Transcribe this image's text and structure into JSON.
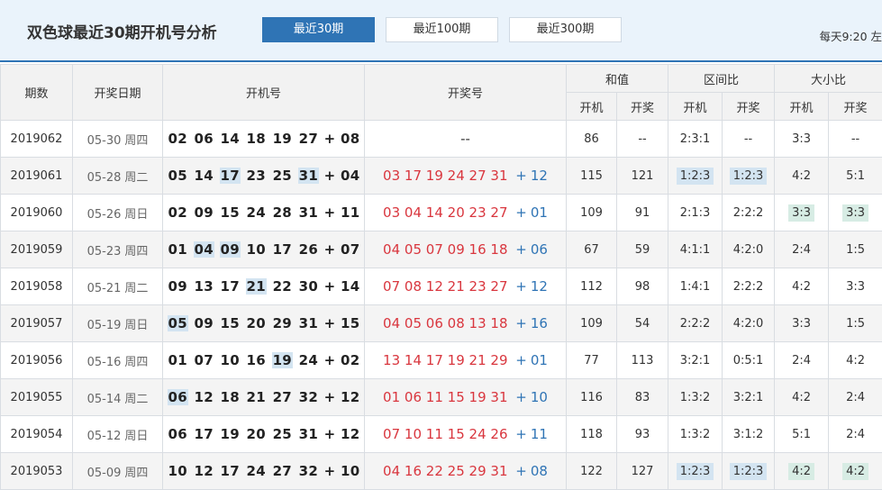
{
  "header": {
    "title": "双色球最近30期开机号分析",
    "tabs": [
      {
        "label": "最近30期",
        "active": true
      },
      {
        "label": "最近100期",
        "active": false
      },
      {
        "label": "最近300期",
        "active": false
      }
    ],
    "update_note": "每天9:20 左"
  },
  "columns": {
    "period": "期数",
    "date": "开奖日期",
    "machine": "开机号",
    "draw": "开奖号",
    "sum": "和值",
    "zone": "区间比",
    "size": "大小比",
    "sub_machine": "开机",
    "sub_draw": "开奖"
  },
  "colors": {
    "accent": "#2f74b5",
    "red_ball": "#d9363e",
    "blue_ball": "#2f74b5",
    "highlight": "#d3e4f1",
    "highlight_green": "#d7ece4"
  },
  "rows": [
    {
      "period": "2019062",
      "date": "05-30",
      "weekday": "周四",
      "machine_red": [
        "02",
        "06",
        "14",
        "18",
        "19",
        "27"
      ],
      "machine_blue": "08",
      "machine_hl": [],
      "draw_red": [],
      "draw_blue": "",
      "draw_empty": "--",
      "plus": "+",
      "sum_m": "86",
      "sum_d": "--",
      "zone_m": "2:3:1",
      "zone_d": "--",
      "zone_hl": false,
      "size_m": "3:3",
      "size_d": "--",
      "size_hl": false
    },
    {
      "period": "2019061",
      "date": "05-28",
      "weekday": "周二",
      "machine_red": [
        "05",
        "14",
        "17",
        "23",
        "25",
        "31"
      ],
      "machine_blue": "04",
      "machine_hl": [
        2,
        5
      ],
      "draw_red": [
        "03",
        "17",
        "19",
        "24",
        "27",
        "31"
      ],
      "draw_blue": "12",
      "plus": "+",
      "sum_m": "115",
      "sum_d": "121",
      "zone_m": "1:2:3",
      "zone_d": "1:2:3",
      "zone_hl": true,
      "size_m": "4:2",
      "size_d": "5:1",
      "size_hl": false
    },
    {
      "period": "2019060",
      "date": "05-26",
      "weekday": "周日",
      "machine_red": [
        "02",
        "09",
        "15",
        "24",
        "28",
        "31"
      ],
      "machine_blue": "11",
      "machine_hl": [],
      "draw_red": [
        "03",
        "04",
        "14",
        "20",
        "23",
        "27"
      ],
      "draw_blue": "01",
      "plus": "+",
      "sum_m": "109",
      "sum_d": "91",
      "zone_m": "2:1:3",
      "zone_d": "2:2:2",
      "zone_hl": false,
      "size_m": "3:3",
      "size_d": "3:3",
      "size_hl": true
    },
    {
      "period": "2019059",
      "date": "05-23",
      "weekday": "周四",
      "machine_red": [
        "01",
        "04",
        "09",
        "10",
        "17",
        "26"
      ],
      "machine_blue": "07",
      "machine_hl": [
        1,
        2
      ],
      "draw_red": [
        "04",
        "05",
        "07",
        "09",
        "16",
        "18"
      ],
      "draw_blue": "06",
      "plus": "+",
      "sum_m": "67",
      "sum_d": "59",
      "zone_m": "4:1:1",
      "zone_d": "4:2:0",
      "zone_hl": false,
      "size_m": "2:4",
      "size_d": "1:5",
      "size_hl": false
    },
    {
      "period": "2019058",
      "date": "05-21",
      "weekday": "周二",
      "machine_red": [
        "09",
        "13",
        "17",
        "21",
        "22",
        "30"
      ],
      "machine_blue": "14",
      "machine_hl": [
        3
      ],
      "draw_red": [
        "07",
        "08",
        "12",
        "21",
        "23",
        "27"
      ],
      "draw_blue": "12",
      "plus": "+",
      "sum_m": "112",
      "sum_d": "98",
      "zone_m": "1:4:1",
      "zone_d": "2:2:2",
      "zone_hl": false,
      "size_m": "4:2",
      "size_d": "3:3",
      "size_hl": false
    },
    {
      "period": "2019057",
      "date": "05-19",
      "weekday": "周日",
      "machine_red": [
        "05",
        "09",
        "15",
        "20",
        "29",
        "31"
      ],
      "machine_blue": "15",
      "machine_hl": [
        0
      ],
      "draw_red": [
        "04",
        "05",
        "06",
        "08",
        "13",
        "18"
      ],
      "draw_blue": "16",
      "plus": "+",
      "sum_m": "109",
      "sum_d": "54",
      "zone_m": "2:2:2",
      "zone_d": "4:2:0",
      "zone_hl": false,
      "size_m": "3:3",
      "size_d": "1:5",
      "size_hl": false
    },
    {
      "period": "2019056",
      "date": "05-16",
      "weekday": "周四",
      "machine_red": [
        "01",
        "07",
        "10",
        "16",
        "19",
        "24"
      ],
      "machine_blue": "02",
      "machine_hl": [
        4
      ],
      "draw_red": [
        "13",
        "14",
        "17",
        "19",
        "21",
        "29"
      ],
      "draw_blue": "01",
      "plus": "+",
      "sum_m": "77",
      "sum_d": "113",
      "zone_m": "3:2:1",
      "zone_d": "0:5:1",
      "zone_hl": false,
      "size_m": "2:4",
      "size_d": "4:2",
      "size_hl": false
    },
    {
      "period": "2019055",
      "date": "05-14",
      "weekday": "周二",
      "machine_red": [
        "06",
        "12",
        "18",
        "21",
        "27",
        "32"
      ],
      "machine_blue": "12",
      "machine_hl": [
        0
      ],
      "draw_red": [
        "01",
        "06",
        "11",
        "15",
        "19",
        "31"
      ],
      "draw_blue": "10",
      "plus": "+",
      "sum_m": "116",
      "sum_d": "83",
      "zone_m": "1:3:2",
      "zone_d": "3:2:1",
      "zone_hl": false,
      "size_m": "4:2",
      "size_d": "2:4",
      "size_hl": false
    },
    {
      "period": "2019054",
      "date": "05-12",
      "weekday": "周日",
      "machine_red": [
        "06",
        "17",
        "19",
        "20",
        "25",
        "31"
      ],
      "machine_blue": "12",
      "machine_hl": [],
      "draw_red": [
        "07",
        "10",
        "11",
        "15",
        "24",
        "26"
      ],
      "draw_blue": "11",
      "plus": "+",
      "sum_m": "118",
      "sum_d": "93",
      "zone_m": "1:3:2",
      "zone_d": "3:1:2",
      "zone_hl": false,
      "size_m": "5:1",
      "size_d": "2:4",
      "size_hl": false
    },
    {
      "period": "2019053",
      "date": "05-09",
      "weekday": "周四",
      "machine_red": [
        "10",
        "12",
        "17",
        "24",
        "27",
        "32"
      ],
      "machine_blue": "10",
      "machine_hl": [],
      "draw_red": [
        "04",
        "16",
        "22",
        "25",
        "29",
        "31"
      ],
      "draw_blue": "08",
      "plus": "+",
      "sum_m": "122",
      "sum_d": "127",
      "zone_m": "1:2:3",
      "zone_d": "1:2:3",
      "zone_hl": true,
      "size_m": "4:2",
      "size_d": "4:2",
      "size_hl": true
    }
  ]
}
